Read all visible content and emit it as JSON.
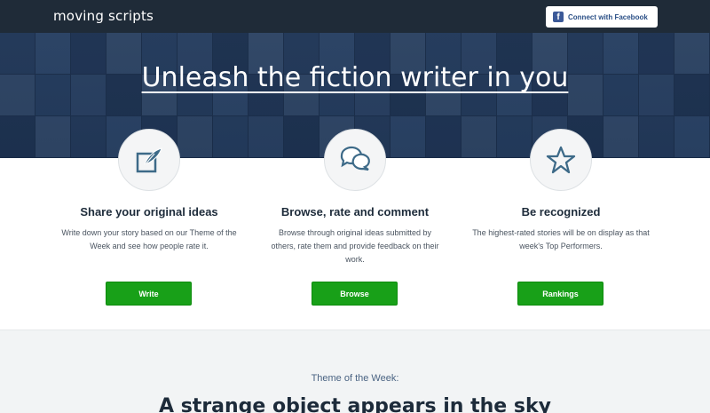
{
  "nav": {
    "logo": "moving scripts",
    "facebook_button": "Connect with Facebook"
  },
  "hero": {
    "title": "Unleash the fiction writer in you"
  },
  "features": [
    {
      "icon": "quill-icon",
      "title": "Share your original ideas",
      "description": "Write down your story based on our Theme of the Week and see how people rate it.",
      "button": "Write"
    },
    {
      "icon": "chat-bubbles-icon",
      "title": "Browse, rate and comment",
      "description": "Browse through original ideas submitted by others, rate them and provide feedback on their work.",
      "button": "Browse"
    },
    {
      "icon": "star-icon",
      "title": "Be recognized",
      "description": "The highest-rated stories will be on display as that week's Top Performers.",
      "button": "Rankings"
    }
  ],
  "theme": {
    "label": "Theme of the Week:",
    "title": "A strange object appears in the sky"
  },
  "colors": {
    "nav_bg": "#1f2b38",
    "hero_tint": "#33496a",
    "accent_green": "#18a018",
    "icon_blue": "#3d6a88",
    "facebook_blue": "#3b5998"
  }
}
